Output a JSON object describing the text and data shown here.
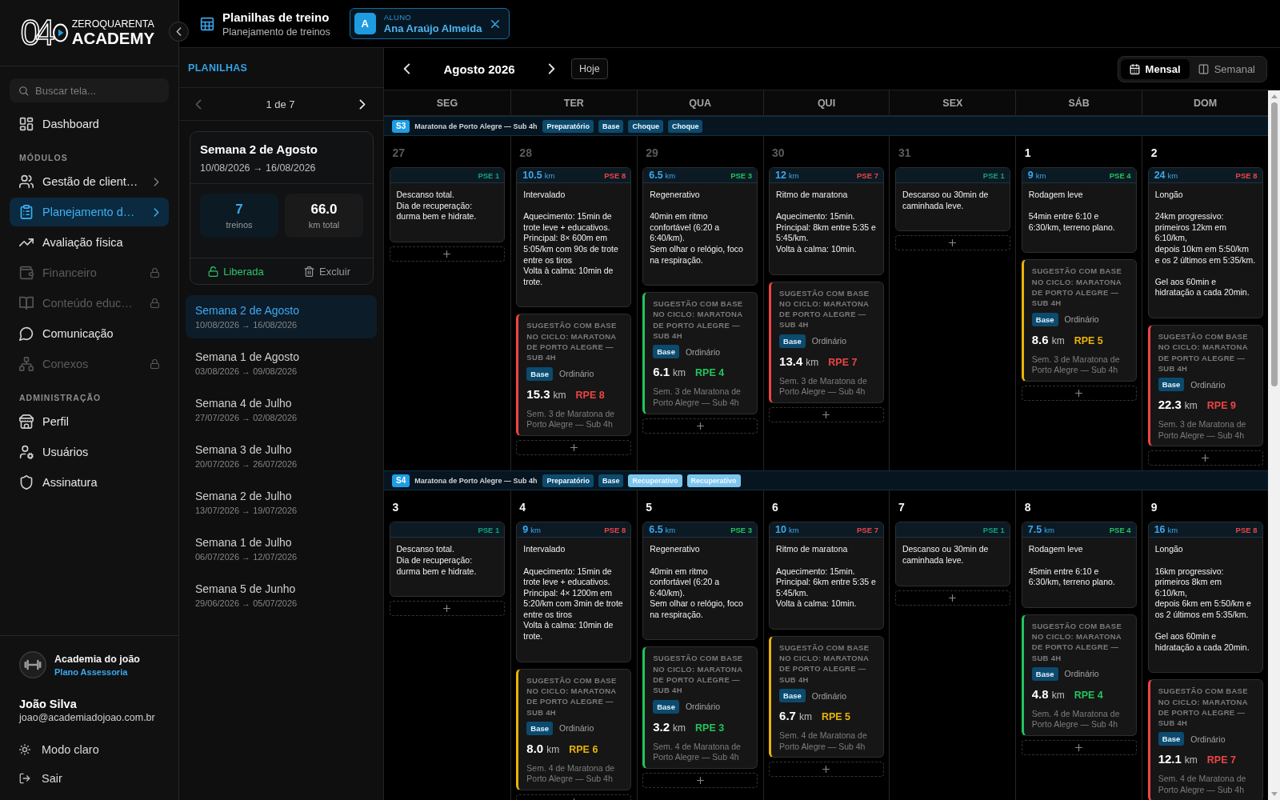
{
  "sidebar": {
    "logo": {
      "mark": "04",
      "top": "ZEROQUARENTA",
      "bottom": "ACADEMY"
    },
    "search": {
      "placeholder": "Buscar tela..."
    },
    "nav": [
      {
        "kind": "item",
        "label": "Dashboard",
        "selected": false,
        "locked": false,
        "submenu": false
      },
      {
        "kind": "heading",
        "label": "MÓDULOS"
      },
      {
        "kind": "item",
        "label": "Gestão de client…",
        "selected": false,
        "locked": false,
        "submenu": true
      },
      {
        "kind": "item",
        "label": "Planejamento d…",
        "selected": true,
        "locked": false,
        "submenu": true
      },
      {
        "kind": "item",
        "label": "Avaliação física",
        "selected": false,
        "locked": false,
        "submenu": false
      },
      {
        "kind": "item",
        "label": "Financeiro",
        "selected": false,
        "locked": true,
        "submenu": false
      },
      {
        "kind": "item",
        "label": "Conteúdo educ…",
        "selected": false,
        "locked": true,
        "submenu": false
      },
      {
        "kind": "item",
        "label": "Comunicação",
        "selected": false,
        "locked": false,
        "submenu": false
      },
      {
        "kind": "item",
        "label": "Conexos",
        "selected": false,
        "locked": true,
        "submenu": false
      },
      {
        "kind": "heading",
        "label": "ADMINISTRAÇÃO"
      },
      {
        "kind": "item",
        "label": "Perfil",
        "selected": false,
        "locked": false,
        "submenu": false
      },
      {
        "kind": "item",
        "label": "Usuários",
        "selected": false,
        "locked": false,
        "submenu": false
      },
      {
        "kind": "item",
        "label": "Assinatura",
        "selected": false,
        "locked": false,
        "submenu": false
      }
    ],
    "account": {
      "name": "Academia do joão",
      "plan": "Plano Assessoria"
    },
    "user": {
      "name": "João Silva",
      "email": "joao@academiadojoao.com.br"
    },
    "actions": [
      "Modo claro",
      "Sair"
    ]
  },
  "header": {
    "title": "Planilhas de treino",
    "subtitle": "Planejamento de treinos",
    "student": {
      "initial": "A",
      "label": "ALUNO",
      "name": "Ana Araújo Almeida"
    }
  },
  "planilhas": {
    "title": "PLANILHAS",
    "pager": {
      "text": "1 de 7",
      "prev_disabled": true,
      "next_disabled": false
    },
    "summary": {
      "title": "Semana 2 de Agosto",
      "dates": "10/08/2026 → 16/08/2026",
      "stats": [
        {
          "value": "7",
          "label": "treinos",
          "highlighted": true
        },
        {
          "value": "66.0",
          "label": "km total",
          "highlighted": false
        }
      ],
      "status": {
        "label": "Liberada",
        "released": true
      },
      "delete": "Excluir"
    },
    "weeks": [
      {
        "title": "Semana 2 de Agosto",
        "dates": "10/08/2026 → 16/08/2026",
        "selected": true
      },
      {
        "title": "Semana 1 de Agosto",
        "dates": "03/08/2026 → 09/08/2026",
        "selected": false
      },
      {
        "title": "Semana 4 de Julho",
        "dates": "27/07/2026 → 02/08/2026",
        "selected": false
      },
      {
        "title": "Semana 3 de Julho",
        "dates": "20/07/2026 → 26/07/2026",
        "selected": false
      },
      {
        "title": "Semana 2 de Julho",
        "dates": "13/07/2026 → 19/07/2026",
        "selected": false
      },
      {
        "title": "Semana 1 de Julho",
        "dates": "06/07/2026 → 12/07/2026",
        "selected": false
      },
      {
        "title": "Semana 5 de Junho",
        "dates": "29/06/2026 → 05/07/2026",
        "selected": false
      }
    ]
  },
  "calendar": {
    "month": "Agosto 2026",
    "today": "Hoje",
    "views": [
      {
        "label": "Mensal",
        "selected": true
      },
      {
        "label": "Semanal",
        "selected": false
      }
    ],
    "weekdays": [
      "SEG",
      "TER",
      "QUA",
      "QUI",
      "SEX",
      "SÁB",
      "DOM"
    ],
    "weeks": [
      {
        "badge": "S3",
        "cycle": "Maratona de Porto Alegre — Sub 4h",
        "tags": [
          {
            "label": "Preparatório",
            "color": "#0c4a6e"
          },
          {
            "label": "Base",
            "color": "#0c4a6e"
          },
          {
            "label": "Choque",
            "color": "#0c4a6e"
          },
          {
            "label": "Choque",
            "color": "#0c4a6e"
          }
        ],
        "days": [
          {
            "date": "27",
            "outside_month": true,
            "workout": {
              "kind": "rest",
              "pse": {
                "label": "PSE 1",
                "color": "#12a37a"
              },
              "text": "Descanso total.\nDia de recuperação: durma bem e hidrate."
            }
          },
          {
            "date": "28",
            "outside_month": true,
            "workout": {
              "kind": "run",
              "distance": "10.5",
              "unit": "km",
              "pse": {
                "label": "PSE 8",
                "color": "#ef4444"
              },
              "title": "Intervalado",
              "text": "Aquecimento: 15min de trote leve + educativos.\nPrincipal: 8× 600m em 5:05/km com 90s de trote entre os tiros\nVolta à calma: 10min de trote."
            },
            "suggestion": {
              "heading": "SUGESTÃO COM BASE NO CICLO: MARATONA DE PORTO ALEGRE — SUB 4H",
              "tag": "Base",
              "type": "Ordinário",
              "distance": "15.3",
              "unit": "km",
              "rpe": "RPE 8",
              "color": "#ef4444",
              "source": "Sem. 3 de Maratona de Porto Alegre — Sub 4h"
            }
          },
          {
            "date": "29",
            "outside_month": true,
            "workout": {
              "kind": "run",
              "distance": "6.5",
              "unit": "km",
              "pse": {
                "label": "PSE 3",
                "color": "#22c55e"
              },
              "title": "Regenerativo",
              "text": "40min em ritmo confortável (6:20 a 6:40/km).\nSem olhar o relógio, foco na respiração."
            },
            "suggestion": {
              "heading": "SUGESTÃO COM BASE NO CICLO: MARATONA DE PORTO ALEGRE — SUB 4H",
              "tag": "Base",
              "type": "Ordinário",
              "distance": "6.1",
              "unit": "km",
              "rpe": "RPE 4",
              "color": "#22c55e",
              "source": "Sem. 3 de Maratona de Porto Alegre — Sub 4h"
            }
          },
          {
            "date": "30",
            "outside_month": true,
            "workout": {
              "kind": "run",
              "distance": "12",
              "unit": "km",
              "pse": {
                "label": "PSE 7",
                "color": "#ef4444"
              },
              "title": "Ritmo de maratona",
              "text": "Aquecimento: 15min.\nPrincipal: 8km entre 5:35 e 5:45/km.\nVolta à calma: 10min."
            },
            "suggestion": {
              "heading": "SUGESTÃO COM BASE NO CICLO: MARATONA DE PORTO ALEGRE — SUB 4H",
              "tag": "Base",
              "type": "Ordinário",
              "distance": "13.4",
              "unit": "km",
              "rpe": "RPE 7",
              "color": "#ef4444",
              "source": "Sem. 3 de Maratona de Porto Alegre — Sub 4h"
            }
          },
          {
            "date": "31",
            "outside_month": true,
            "workout": {
              "kind": "rest",
              "pse": {
                "label": "PSE 1",
                "color": "#12a37a"
              },
              "text": "Descanso ou 30min de caminhada leve."
            }
          },
          {
            "date": "1",
            "outside_month": false,
            "workout": {
              "kind": "run",
              "distance": "9",
              "unit": "km",
              "pse": {
                "label": "PSE 4",
                "color": "#22c55e"
              },
              "title": "Rodagem leve",
              "text": "54min entre 6:10 e 6:30/km, terreno plano."
            },
            "suggestion": {
              "heading": "SUGESTÃO COM BASE NO CICLO: MARATONA DE PORTO ALEGRE — SUB 4H",
              "tag": "Base",
              "type": "Ordinário",
              "distance": "8.6",
              "unit": "km",
              "rpe": "RPE 5",
              "color": "#eab308",
              "source": "Sem. 3 de Maratona de Porto Alegre — Sub 4h"
            }
          },
          {
            "date": "2",
            "outside_month": false,
            "workout": {
              "kind": "run",
              "distance": "24",
              "unit": "km",
              "pse": {
                "label": "PSE 8",
                "color": "#ef4444"
              },
              "title": "Longão",
              "text": "24km progressivo: primeiros 12km em 6:10/km,\ndepois 10km em 5:50/km e os 2 últimos em 5:35/km.\n\nGel aos 60min e hidratação a cada 20min."
            },
            "suggestion": {
              "heading": "SUGESTÃO COM BASE NO CICLO: MARATONA DE PORTO ALEGRE — SUB 4H",
              "tag": "Base",
              "type": "Ordinário",
              "distance": "22.3",
              "unit": "km",
              "rpe": "RPE 9",
              "color": "#ef4444",
              "source": "Sem. 3 de Maratona de Porto Alegre — Sub 4h"
            }
          }
        ]
      },
      {
        "badge": "S4",
        "cycle": "Maratona de Porto Alegre — Sub 4h",
        "tags": [
          {
            "label": "Preparatório",
            "color": "#0c4a6e"
          },
          {
            "label": "Base",
            "color": "#0c4a6e"
          },
          {
            "label": "Recuperativo",
            "color": "#7cc6ee"
          },
          {
            "label": "Recuperativo",
            "color": "#7cc6ee"
          }
        ],
        "days": [
          {
            "date": "3",
            "outside_month": false,
            "workout": {
              "kind": "rest",
              "pse": {
                "label": "PSE 1",
                "color": "#12a37a"
              },
              "text": "Descanso total.\nDia de recuperação: durma bem e hidrate."
            }
          },
          {
            "date": "4",
            "outside_month": false,
            "workout": {
              "kind": "run",
              "distance": "9",
              "unit": "km",
              "pse": {
                "label": "PSE 8",
                "color": "#ef4444"
              },
              "title": "Intervalado",
              "text": "Aquecimento: 15min de trote leve + educativos.\nPrincipal: 4× 1200m em 5:20/km com 3min de trote entre os tiros\nVolta à calma: 10min de trote."
            },
            "suggestion": {
              "heading": "SUGESTÃO COM BASE NO CICLO: MARATONA DE PORTO ALEGRE — SUB 4H",
              "tag": "Base",
              "type": "Ordinário",
              "distance": "8.0",
              "unit": "km",
              "rpe": "RPE 6",
              "color": "#eab308",
              "source": "Sem. 4 de Maratona de Porto Alegre — Sub 4h"
            }
          },
          {
            "date": "5",
            "outside_month": false,
            "workout": {
              "kind": "run",
              "distance": "6.5",
              "unit": "km",
              "pse": {
                "label": "PSE 3",
                "color": "#22c55e"
              },
              "title": "Regenerativo",
              "text": "40min em ritmo confortável (6:20 a 6:40/km).\nSem olhar o relógio, foco na respiração."
            },
            "suggestion": {
              "heading": "SUGESTÃO COM BASE NO CICLO: MARATONA DE PORTO ALEGRE — SUB 4H",
              "tag": "Base",
              "type": "Ordinário",
              "distance": "3.2",
              "unit": "km",
              "rpe": "RPE 3",
              "color": "#22c55e",
              "source": "Sem. 4 de Maratona de Porto Alegre — Sub 4h"
            }
          },
          {
            "date": "6",
            "outside_month": false,
            "workout": {
              "kind": "run",
              "distance": "10",
              "unit": "km",
              "pse": {
                "label": "PSE 7",
                "color": "#ef4444"
              },
              "title": "Ritmo de maratona",
              "text": "Aquecimento: 15min.\nPrincipal: 6km entre 5:35 e 5:45/km.\nVolta à calma: 10min."
            },
            "suggestion": {
              "heading": "SUGESTÃO COM BASE NO CICLO: MARATONA DE PORTO ALEGRE — SUB 4H",
              "tag": "Base",
              "type": "Ordinário",
              "distance": "6.7",
              "unit": "km",
              "rpe": "RPE 5",
              "color": "#eab308",
              "source": "Sem. 4 de Maratona de Porto Alegre — Sub 4h"
            }
          },
          {
            "date": "7",
            "outside_month": false,
            "workout": {
              "kind": "rest",
              "pse": {
                "label": "PSE 1",
                "color": "#12a37a"
              },
              "text": "Descanso ou 30min de caminhada leve."
            }
          },
          {
            "date": "8",
            "outside_month": false,
            "workout": {
              "kind": "run",
              "distance": "7.5",
              "unit": "km",
              "pse": {
                "label": "PSE 4",
                "color": "#22c55e"
              },
              "title": "Rodagem leve",
              "text": "45min entre 6:10 e 6:30/km, terreno plano."
            },
            "suggestion": {
              "heading": "SUGESTÃO COM BASE NO CICLO: MARATONA DE PORTO ALEGRE — SUB 4H",
              "tag": "Base",
              "type": "Ordinário",
              "distance": "4.8",
              "unit": "km",
              "rpe": "RPE 4",
              "color": "#22c55e",
              "source": "Sem. 4 de Maratona de Porto Alegre — Sub 4h"
            }
          },
          {
            "date": "9",
            "outside_month": false,
            "workout": {
              "kind": "run",
              "distance": "16",
              "unit": "km",
              "pse": {
                "label": "PSE 8",
                "color": "#ef4444"
              },
              "title": "Longão",
              "text": "16km progressivo: primeiros 8km em 6:10/km,\ndepois 6km em 5:50/km e os 2 últimos em 5:35/km.\n\nGel aos 60min e hidratação a cada 20min."
            },
            "suggestion": {
              "heading": "SUGESTÃO COM BASE NO CICLO: MARATONA DE PORTO ALEGRE — SUB 4H",
              "tag": "Base",
              "type": "Ordinário",
              "distance": "12.1",
              "unit": "km",
              "rpe": "RPE 7",
              "color": "#ef4444",
              "source": "Sem. 4 de Maratona de Porto Alegre — Sub 4h"
            }
          }
        ]
      }
    ]
  }
}
